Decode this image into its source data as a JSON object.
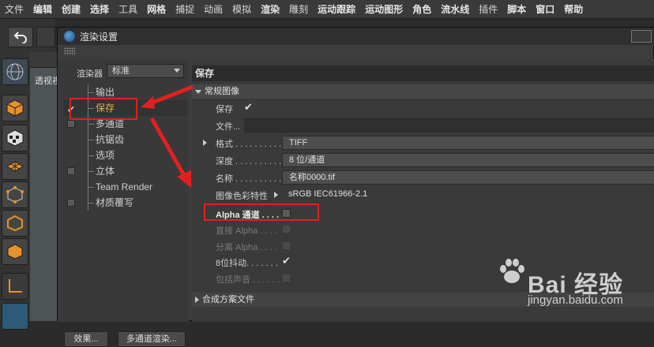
{
  "menubar": {
    "items": [
      "文件",
      "编辑",
      "创建",
      "选择",
      "工具",
      "网格",
      "捕捉",
      "动画",
      "模拟",
      "渲染",
      "雕刻",
      "运动跟踪",
      "运动图形",
      "角色",
      "流水线",
      "插件",
      "脚本",
      "窗口",
      "帮助"
    ]
  },
  "viewport": {
    "label": "透视视"
  },
  "dialog": {
    "title": "渲染设置",
    "renderer_label": "渲染器",
    "renderer_value": "标准",
    "tree": [
      {
        "label": "输出",
        "check": "none"
      },
      {
        "label": "保存",
        "check": "tick",
        "selected": true
      },
      {
        "label": "多通道",
        "check": "box"
      },
      {
        "label": "抗锯齿",
        "check": "none"
      },
      {
        "label": "选项",
        "check": "none"
      },
      {
        "label": "立体",
        "check": "box"
      },
      {
        "label": "Team Render",
        "check": "none"
      },
      {
        "label": "材质覆写",
        "check": "box"
      }
    ],
    "effects_button": "效果...",
    "multipass_button": "多通道渲染...",
    "panel_title": "保存",
    "section_general": "常规图像",
    "section_compositing": "合成方案文件",
    "rows": {
      "save_label": "保存",
      "file_label": "文件...",
      "format_label": "格式 . . . . . . . . . .",
      "format_value": "TIFF",
      "depth_label": "深度 . . . . . . . . . .",
      "depth_value": "8 位/通道",
      "name_label": "名称 . . . . . . . . . .",
      "name_value": "名称0000.tif",
      "profile_label": "图像色彩特性",
      "profile_value": "sRGB IEC61966-2.1",
      "alpha_label": "Alpha 通道 . . . .",
      "straight_alpha_label": "直接 Alpha . . . .",
      "separate_alpha_label": "分离 Alpha . . . .",
      "dither_label": "8位抖动. . . . . . .",
      "sound_label": "包括声音 . . . . . ."
    }
  },
  "watermark": {
    "brand": "Bai 经验",
    "url": "jingyan.baidu.com"
  },
  "colors": {
    "accent_selected": "#f0a83a",
    "annotation_red": "#e02020"
  }
}
